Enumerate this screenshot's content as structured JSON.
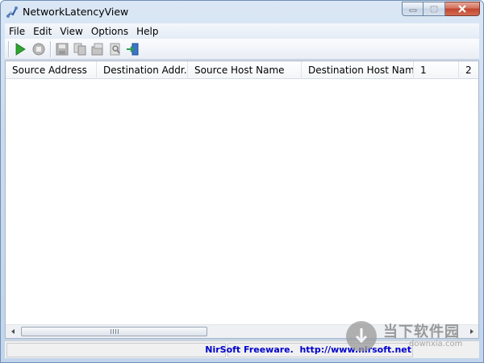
{
  "window": {
    "title": "NetworkLatencyView",
    "icon": "network-app-icon"
  },
  "menu": [
    "File",
    "Edit",
    "View",
    "Options",
    "Help"
  ],
  "toolbar": {
    "buttons": [
      "start-icon",
      "stop-icon",
      "save-icon",
      "copy-icon",
      "properties-icon",
      "find-icon",
      "exit-icon"
    ]
  },
  "columns": [
    "Source Address",
    "Destination Addr...",
    "Source Host Name",
    "Destination Host Name",
    "1",
    "2"
  ],
  "rows": [],
  "status": {
    "link_text": "NirSoft Freeware.  http://www.nirsoft.net"
  },
  "watermark": {
    "text": "当下软件园",
    "sub": "downxia.com"
  }
}
